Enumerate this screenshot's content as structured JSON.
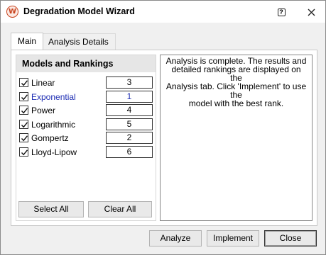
{
  "window": {
    "title": "Degradation Model Wizard",
    "app_icon_letter": "W",
    "help_glyph": "?"
  },
  "tabs": [
    {
      "label": "Main",
      "active": true
    },
    {
      "label": "Analysis Details",
      "active": false
    }
  ],
  "models": {
    "header": "Models and Rankings",
    "items": [
      {
        "name": "Linear",
        "checked": true,
        "rank": "3",
        "selected": false
      },
      {
        "name": "Exponential",
        "checked": true,
        "rank": "1",
        "selected": true
      },
      {
        "name": "Power",
        "checked": true,
        "rank": "4",
        "selected": false
      },
      {
        "name": "Logarithmic",
        "checked": true,
        "rank": "5",
        "selected": false
      },
      {
        "name": "Gompertz",
        "checked": true,
        "rank": "2",
        "selected": false
      },
      {
        "name": "Lloyd-Lipow",
        "checked": true,
        "rank": "6",
        "selected": false
      }
    ],
    "select_all_label": "Select All",
    "clear_all_label": "Clear All"
  },
  "analysis": {
    "message_lines": [
      "Analysis is complete. The results and",
      "detailed rankings are displayed on the",
      "Analysis tab. Click 'Implement' to use the",
      "model with the best rank."
    ]
  },
  "footer": {
    "analyze_label": "Analyze",
    "implement_label": "Implement",
    "close_label": "Close"
  },
  "colors": {
    "selected_text": "#1f2fb4",
    "icon_accent": "#c8441f"
  }
}
